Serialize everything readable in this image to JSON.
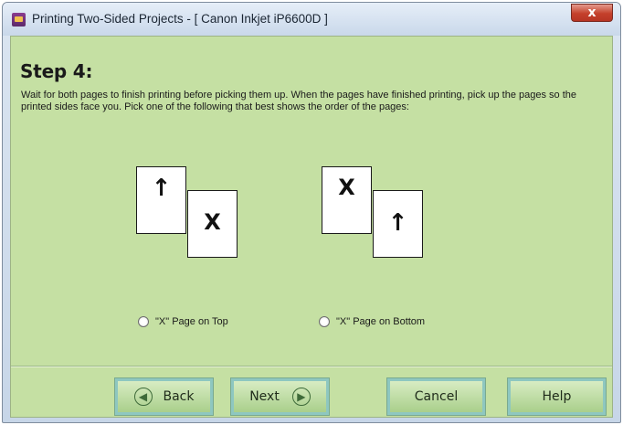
{
  "window": {
    "title": "Printing Two-Sided Projects - [ Canon Inkjet iP6600D ]",
    "close_glyph": "x",
    "icon": "printer-app-icon"
  },
  "step": {
    "title": "Step 4:",
    "instructions": "Wait for both pages to finish printing before picking them up.  When  the pages have finished printing, pick up the pages so the printed sides face you.  Pick one of the following that best shows the order of the pages:"
  },
  "illustrations": {
    "arrow_glyph": "↑",
    "x_glyph": "X"
  },
  "options": [
    {
      "label": "\"X\" Page on Top",
      "selected": false
    },
    {
      "label": "\"X\" Page on Bottom",
      "selected": false
    }
  ],
  "buttons": {
    "back": "Back",
    "next": "Next",
    "cancel": "Cancel",
    "help": "Help",
    "back_icon": "arrow-left-circle-icon",
    "next_icon": "arrow-right-circle-icon"
  },
  "colors": {
    "panel_background": "#c5e0a3",
    "button_border": "#8ec7c0",
    "close_button": "#c4402b"
  }
}
